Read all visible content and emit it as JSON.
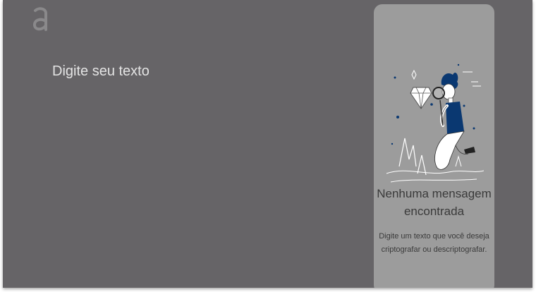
{
  "logo": {
    "icon": "alura-logo-icon"
  },
  "editor": {
    "placeholder": "Digite seu texto"
  },
  "result": {
    "illustration_icon": "search-person-magnifier-illustration",
    "empty_title": "Nenhuma mensagem encontrada",
    "empty_description": "Digite um texto que você deseja criptografar ou descriptografar."
  },
  "colors": {
    "background": "#666467",
    "panel": "#9c9c9c",
    "accent": "#0a3871",
    "text_light": "#e4e4e4",
    "text_dark": "#3a3a3a"
  }
}
